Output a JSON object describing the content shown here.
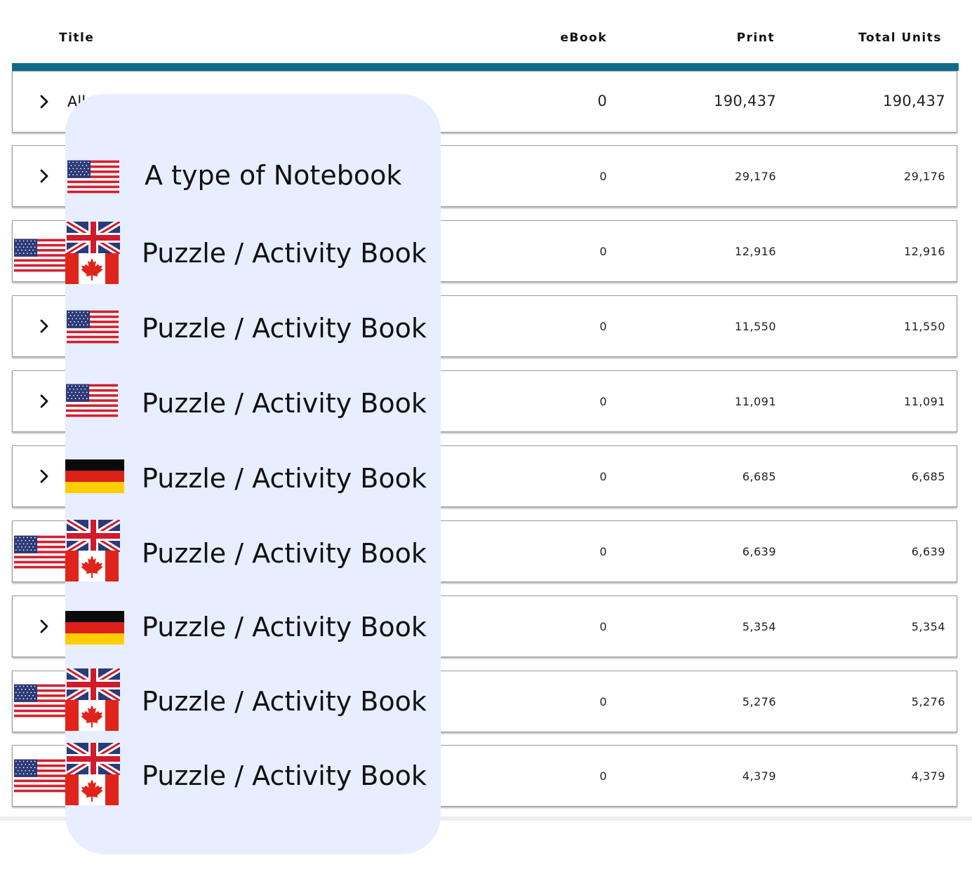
{
  "columns": {
    "title": "Title",
    "ebook": "eBook",
    "print": "Print",
    "total_units": "Total Units"
  },
  "total_row": {
    "label": "All",
    "ebook": "0",
    "print": "190,437",
    "total": "190,437"
  },
  "rows": [
    {
      "title": "A type of Notebook",
      "ebook": "0",
      "print": "29,176",
      "total": "29,176",
      "flags": [
        "us-flag-icon"
      ]
    },
    {
      "title": "Puzzle / Activity Book",
      "ebook": "0",
      "print": "12,916",
      "total": "12,916",
      "flags": [
        "us-flag-icon",
        "uk-flag-icon",
        "canada-flag-icon"
      ]
    },
    {
      "title": "Puzzle / Activity Book",
      "ebook": "0",
      "print": "11,550",
      "total": "11,550",
      "flags": [
        "us-flag-icon"
      ]
    },
    {
      "title": "Puzzle / Activity Book",
      "ebook": "0",
      "print": "11,091",
      "total": "11,091",
      "flags": [
        "us-flag-icon"
      ]
    },
    {
      "title": "Puzzle / Activity Book",
      "ebook": "0",
      "print": "6,685",
      "total": "6,685",
      "flags": [
        "germany-flag-icon"
      ]
    },
    {
      "title": "Puzzle / Activity Book",
      "ebook": "0",
      "print": "6,639",
      "total": "6,639",
      "flags": [
        "us-flag-icon",
        "uk-flag-icon",
        "canada-flag-icon"
      ]
    },
    {
      "title": "Puzzle / Activity Book",
      "ebook": "0",
      "print": "5,354",
      "total": "5,354",
      "flags": [
        "germany-flag-icon"
      ]
    },
    {
      "title": "Puzzle / Activity Book",
      "ebook": "0",
      "print": "5,276",
      "total": "5,276",
      "flags": [
        "us-flag-icon",
        "uk-flag-icon",
        "canada-flag-icon"
      ]
    },
    {
      "title": "Puzzle / Activity Book",
      "ebook": "0",
      "print": "4,379",
      "total": "4,379",
      "flags": [
        "us-flag-icon",
        "uk-flag-icon",
        "canada-flag-icon"
      ]
    }
  ],
  "colors": {
    "accent_bar": "#0e6b8c",
    "overlay_panel": "#e7eeff"
  }
}
